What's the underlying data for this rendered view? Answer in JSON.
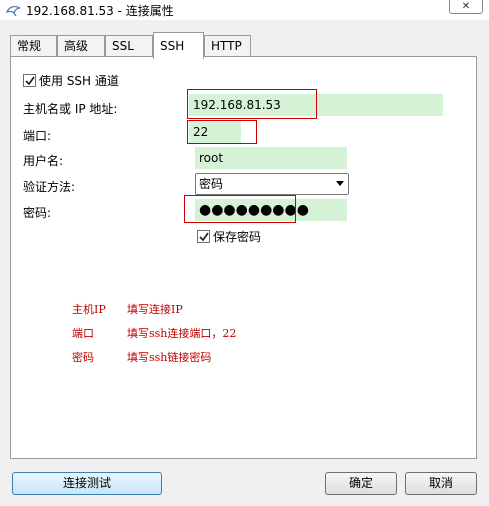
{
  "window": {
    "title": "192.168.81.53 - 连接属性",
    "close_label": "✕"
  },
  "tabs": [
    {
      "label": "常规",
      "active": false
    },
    {
      "label": "高级",
      "active": false
    },
    {
      "label": "SSL",
      "active": false
    },
    {
      "label": "SSH",
      "active": true
    },
    {
      "label": "HTTP",
      "active": false
    }
  ],
  "ssh": {
    "use_ssh_label": "使用 SSH 通道",
    "use_ssh_checked": true,
    "host_label": "主机名或 IP 地址:",
    "host_value": "192.168.81.53",
    "port_label": "端口:",
    "port_value": "22",
    "username_label": "用户名:",
    "username_value": "root",
    "auth_label": "验证方法:",
    "auth_value": "密码",
    "password_label": "密码:",
    "password_value": "●●●●●●●●●",
    "save_password_label": "保存密码",
    "save_password_checked": true
  },
  "annotations": [
    {
      "key": "主机IP",
      "text": "填写连接IP"
    },
    {
      "key": "端口",
      "text": "填写ssh连接端口，22"
    },
    {
      "key": "密码",
      "text": "填写ssh链接密码"
    }
  ],
  "buttons": {
    "test": "连接测试",
    "ok": "确定",
    "cancel": "取消"
  },
  "colors": {
    "field_bg": "#d6f2d6",
    "highlight_box": "#d00000",
    "annotation_text": "#c00000"
  }
}
